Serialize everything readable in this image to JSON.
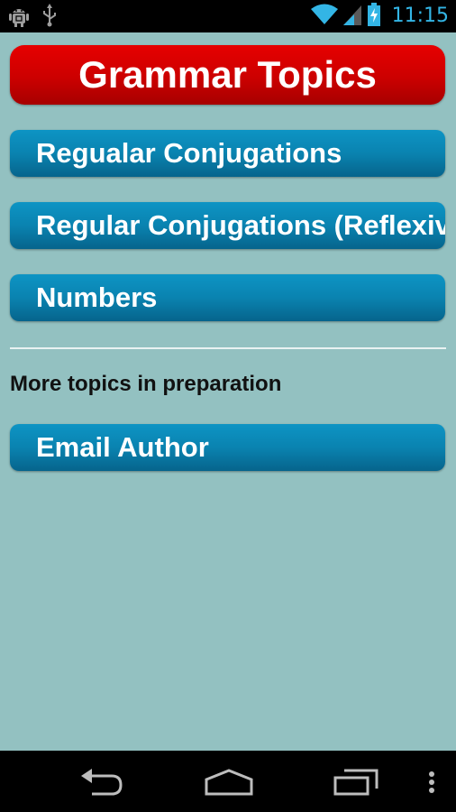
{
  "status_bar": {
    "time": "11:15",
    "icons": [
      "android-debug-icon",
      "usb-icon",
      "wifi-icon",
      "signal-icon",
      "battery-charging-icon"
    ],
    "accent_color": "#33b5e5"
  },
  "header": {
    "title": "Grammar Topics",
    "color": "#cc0000"
  },
  "topics": [
    {
      "label": "Regualar Conjugations"
    },
    {
      "label": "Regular Conjugations (Reflexive)"
    },
    {
      "label": "Numbers"
    }
  ],
  "note": "More topics in preparation",
  "email_button": {
    "label": "Email Author"
  },
  "colors": {
    "background": "#93c1c1",
    "button": "#0a83b0"
  },
  "nav_bar": {
    "icons": [
      "back-icon",
      "home-icon",
      "recent-apps-icon",
      "overflow-menu-icon"
    ]
  }
}
